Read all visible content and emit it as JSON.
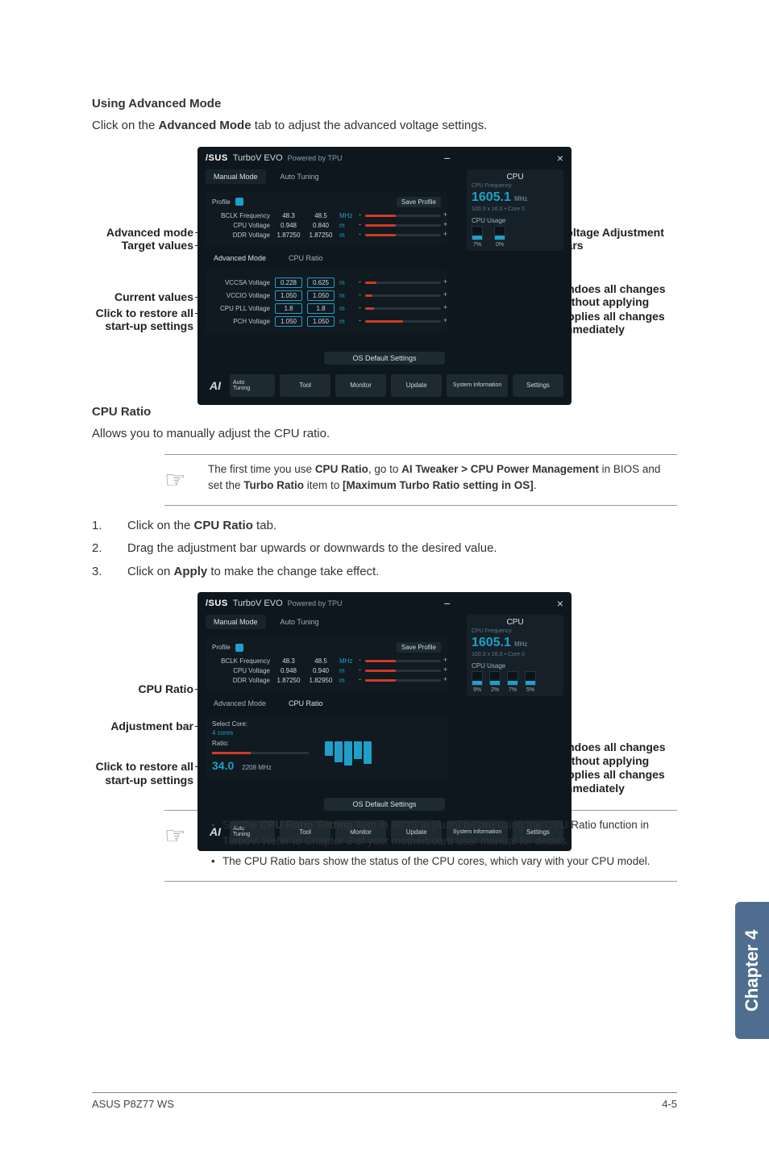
{
  "section1": {
    "heading": "Using Advanced Mode",
    "intro_before": "Click on the ",
    "intro_bold": "Advanced Mode",
    "intro_after": " tab to adjust the advanced voltage settings."
  },
  "callouts1": {
    "advanced_mode": "Advanced mode",
    "target_values": "Target values",
    "current_values": "Current values",
    "click_restore": "Click to restore all start-up settings",
    "voltage_bars": "Voltage Adjustment bars",
    "undoes": "Undoes all changes without applying",
    "applies": "Applies all changes immediately"
  },
  "app1": {
    "brand": "/SUS",
    "title": "TurboV EVO",
    "subtitle": "Powered by TPU",
    "tabs": {
      "manual": "Manual Mode",
      "auto": "Auto Tuning"
    },
    "cpu": {
      "hdr": "CPU",
      "freq_label": "CPU Frequency",
      "freq": "1605.1",
      "unit": "MHz",
      "detail": "100.3 x 16.0  •  Core 0",
      "usage_hdr": "CPU Usage",
      "u1": "7%",
      "u2": "0%"
    },
    "profile": {
      "lbl": "Profile",
      "save": "Save Profile"
    },
    "rows": [
      {
        "lbl": "BCLK Frequency",
        "v1": "48.3",
        "v2": "48.5",
        "unit": "MHz"
      },
      {
        "lbl": "CPU Voltage",
        "v1": "0.948",
        "v2": "0.840",
        "unit": "m"
      },
      {
        "lbl": "DDR Voltage",
        "v1": "1.87250",
        "v2": "1.87250",
        "unit": "m"
      }
    ],
    "adv_tabs": {
      "adv": "Advanced Mode",
      "cpu_ratio": "CPU Ratio"
    },
    "adv_rows": [
      {
        "lbl": "VCCSA Voltage",
        "v1": "0.228",
        "v2": "0.625",
        "unit": "m"
      },
      {
        "lbl": "VCCIO Voltage",
        "v1": "1.050",
        "v2": "1.050",
        "unit": "m"
      },
      {
        "lbl": "CPU PLL Voltage",
        "v1": "1.8",
        "v2": "1.8",
        "unit": "m"
      },
      {
        "lbl": "PCH Voltage",
        "v1": "1.050",
        "v2": "1.050",
        "unit": "m"
      }
    ],
    "os_default": "OS Default Settings",
    "bottom": {
      "auto1": "Auto",
      "auto2": "Tuning",
      "tool": "Tool",
      "monitor": "Monitor",
      "update": "Update",
      "sysinfo": "System Information",
      "settings": "Settings"
    }
  },
  "section2": {
    "heading": "CPU Ratio",
    "intro": "Allows you to manually adjust the CPU ratio."
  },
  "note1": {
    "before": "The first time you use ",
    "b1": "CPU Ratio",
    "mid1": ", go to ",
    "b2": "AI Tweaker > CPU Power Management",
    "mid2": " in BIOS and set the ",
    "b3": "Turbo Ratio",
    "mid3": " item to ",
    "b4": "[Maximum Turbo Ratio setting in OS]",
    "after": "."
  },
  "steps": [
    {
      "n": "1.",
      "before": "Click on the ",
      "b": "CPU Ratio",
      "after": " tab."
    },
    {
      "n": "2.",
      "before": "Drag the adjustment bar upwards or downwards to the desired value.",
      "b": "",
      "after": ""
    },
    {
      "n": "3.",
      "before": "Click on ",
      "b": "Apply",
      "after": " to make the change take effect."
    }
  ],
  "callouts2": {
    "cpu_ratio": "CPU Ratio",
    "adjustment_bar": "Adjustment bar",
    "click_restore": "Click to restore all start-up settings",
    "undoes": "Undoes all changes without applying",
    "applies": "Applies all changes immediately"
  },
  "app2": {
    "brand": "/SUS",
    "title": "TurboV EVO",
    "subtitle": "Powered by TPU",
    "tabs": {
      "manual": "Manual Mode",
      "auto": "Auto Tuning"
    },
    "cpu": {
      "hdr": "CPU",
      "freq_label": "CPU Frequency",
      "freq": "1605.1",
      "unit": "MHz",
      "detail": "100.3 x 16.0  •  Core 0",
      "usage_hdr": "CPU Usage",
      "u1": "9%",
      "u2": "2%",
      "u3": "7%",
      "u4": "5%"
    },
    "profile": {
      "lbl": "Profile",
      "save": "Save Profile"
    },
    "rows": [
      {
        "lbl": "BCLK Frequency",
        "v1": "48.3",
        "v2": "48.5",
        "unit": "MHz"
      },
      {
        "lbl": "CPU Voltage",
        "v1": "0.948",
        "v2": "0.940",
        "unit": "m"
      },
      {
        "lbl": "DDR Voltage",
        "v1": "1.87250",
        "v2": "1.82950",
        "unit": "m"
      }
    ],
    "adv_tabs": {
      "adv": "Advanced Mode",
      "cpu_ratio": "CPU Ratio"
    },
    "ratio": {
      "select": "Select Core:",
      "all": "4 cores",
      "ratio_lbl": "Ratio:",
      "big": "34.0",
      "mhz": "2208 MHz"
    },
    "os_default": "OS Default Settings",
    "bottom": {
      "auto1": "Auto",
      "auto2": "Tuning",
      "tool": "Tool",
      "monitor": "Monitor",
      "update": "Update",
      "sysinfo": "System Information",
      "settings": "Settings"
    }
  },
  "note2": {
    "li1_before": "Set the ",
    "li1_b": "CPU Ratio Setting",
    "li1_after": " item in BIOS to [Auto] before using the CPU Ratio function in TurboV. Refer to Chapter 3 of your motherboard user manual for details.",
    "li2": "The CPU Ratio bars show the status of the CPU cores, which vary with your CPU model."
  },
  "chapter_tab": "Chapter 4",
  "footer": {
    "left": "ASUS P8Z77 WS",
    "right": "4-5"
  }
}
